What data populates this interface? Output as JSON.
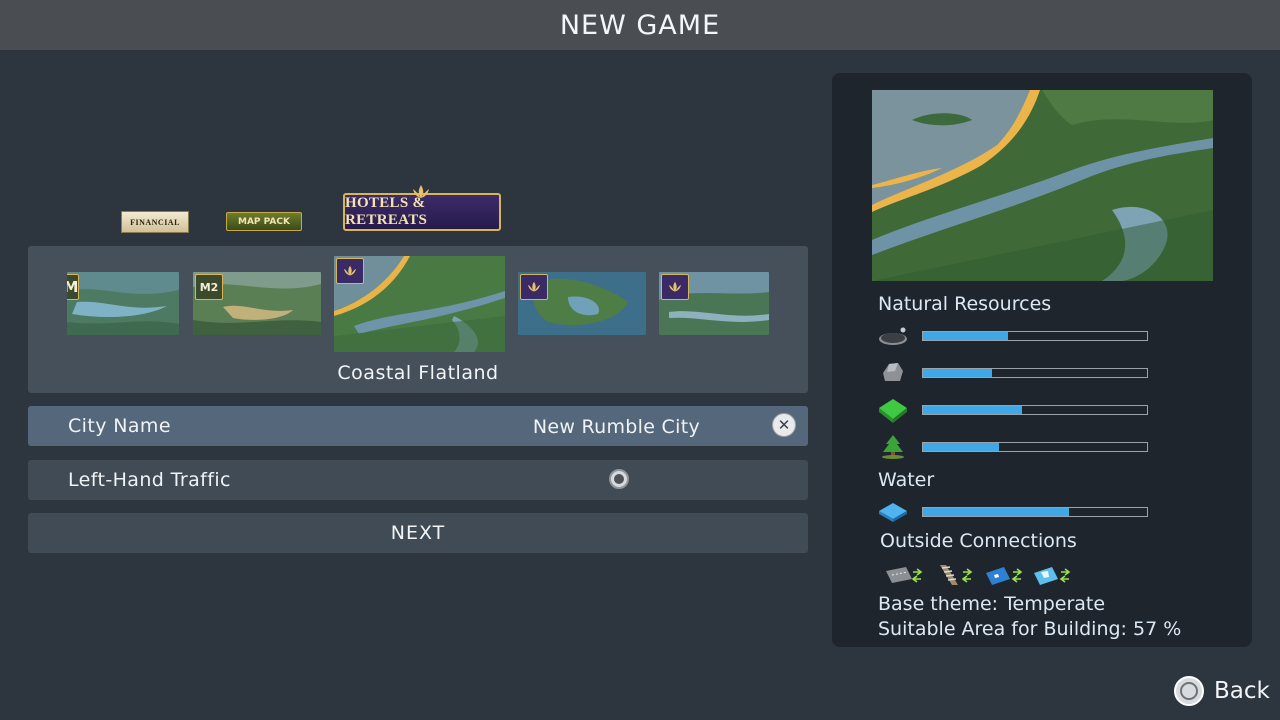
{
  "header": {
    "title": "NEW GAME"
  },
  "dlc_filters": [
    {
      "label": "FINANCIAL",
      "icon": "financial-districts-logo"
    },
    {
      "label": "MAP PACK",
      "icon": "map-pack-logo"
    },
    {
      "label": "HOTELS & RETREATS",
      "icon": "hotels-retreats-logo",
      "selected": true
    }
  ],
  "maps": {
    "thumbnails": [
      {
        "badge": "M"
      },
      {
        "badge": "M2"
      },
      {
        "badge": "hotels",
        "selected": true
      },
      {
        "badge": "hotels"
      },
      {
        "badge": "hotels"
      }
    ],
    "selected_name": "Coastal Flatland"
  },
  "city_name": {
    "label": "City Name",
    "value": "New Rumble City"
  },
  "traffic": {
    "label": "Left-Hand Traffic",
    "enabled": false
  },
  "next_label": "NEXT",
  "info_panel": {
    "natural_resources_title": "Natural Resources",
    "resources": [
      {
        "icon": "oil-icon",
        "level": 0.38
      },
      {
        "icon": "ore-icon",
        "level": 0.31
      },
      {
        "icon": "fertile-land-icon",
        "level": 0.44
      },
      {
        "icon": "forest-icon",
        "level": 0.34
      }
    ],
    "water_title": "Water",
    "water": {
      "icon": "water-icon",
      "level": 0.65
    },
    "outside_connections_title": "Outside Connections",
    "connections": [
      "highway-connection-icon",
      "rail-connection-icon",
      "ship-connection-icon",
      "plane-connection-icon"
    ],
    "base_theme": "Base theme: Temperate",
    "suitable_area": "Suitable Area for Building: 57 %"
  },
  "back_label": "Back",
  "colors": {
    "accent": "#3fa9e8",
    "panel_bg": "#1e252d",
    "page_bg": "#2d353e",
    "title_bg": "#4a4e53"
  }
}
